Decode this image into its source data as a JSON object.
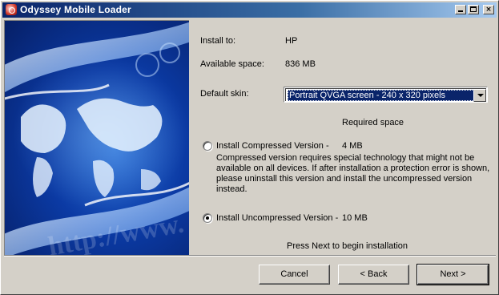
{
  "window": {
    "title": "Odyssey Mobile Loader",
    "controls": {
      "minimize": "minimize",
      "maximize": "maximize",
      "close": "×"
    }
  },
  "banner": {
    "watermark": "http://www."
  },
  "install_to": {
    "label": "Install to:",
    "value": "HP"
  },
  "available_space": {
    "label": "Available space:",
    "value": "836 MB"
  },
  "default_skin": {
    "label": "Default skin:",
    "selected": "Portrait QVGA screen - 240 x 320 pixels"
  },
  "required_space_header": "Required space",
  "options": {
    "compressed": {
      "label": "Install Compressed Version -",
      "size": "4 MB",
      "checked": false,
      "description": "Compressed version requires special technology that might not be available on all devices. If after installation a protection error is shown, please uninstall this version and install the uncompressed version instead."
    },
    "uncompressed": {
      "label": "Install Uncompressed Version -",
      "size": "10 MB",
      "checked": true
    }
  },
  "hint": "Press Next to begin installation",
  "buttons": {
    "cancel": "Cancel",
    "back": "< Back",
    "next": "Next >"
  }
}
